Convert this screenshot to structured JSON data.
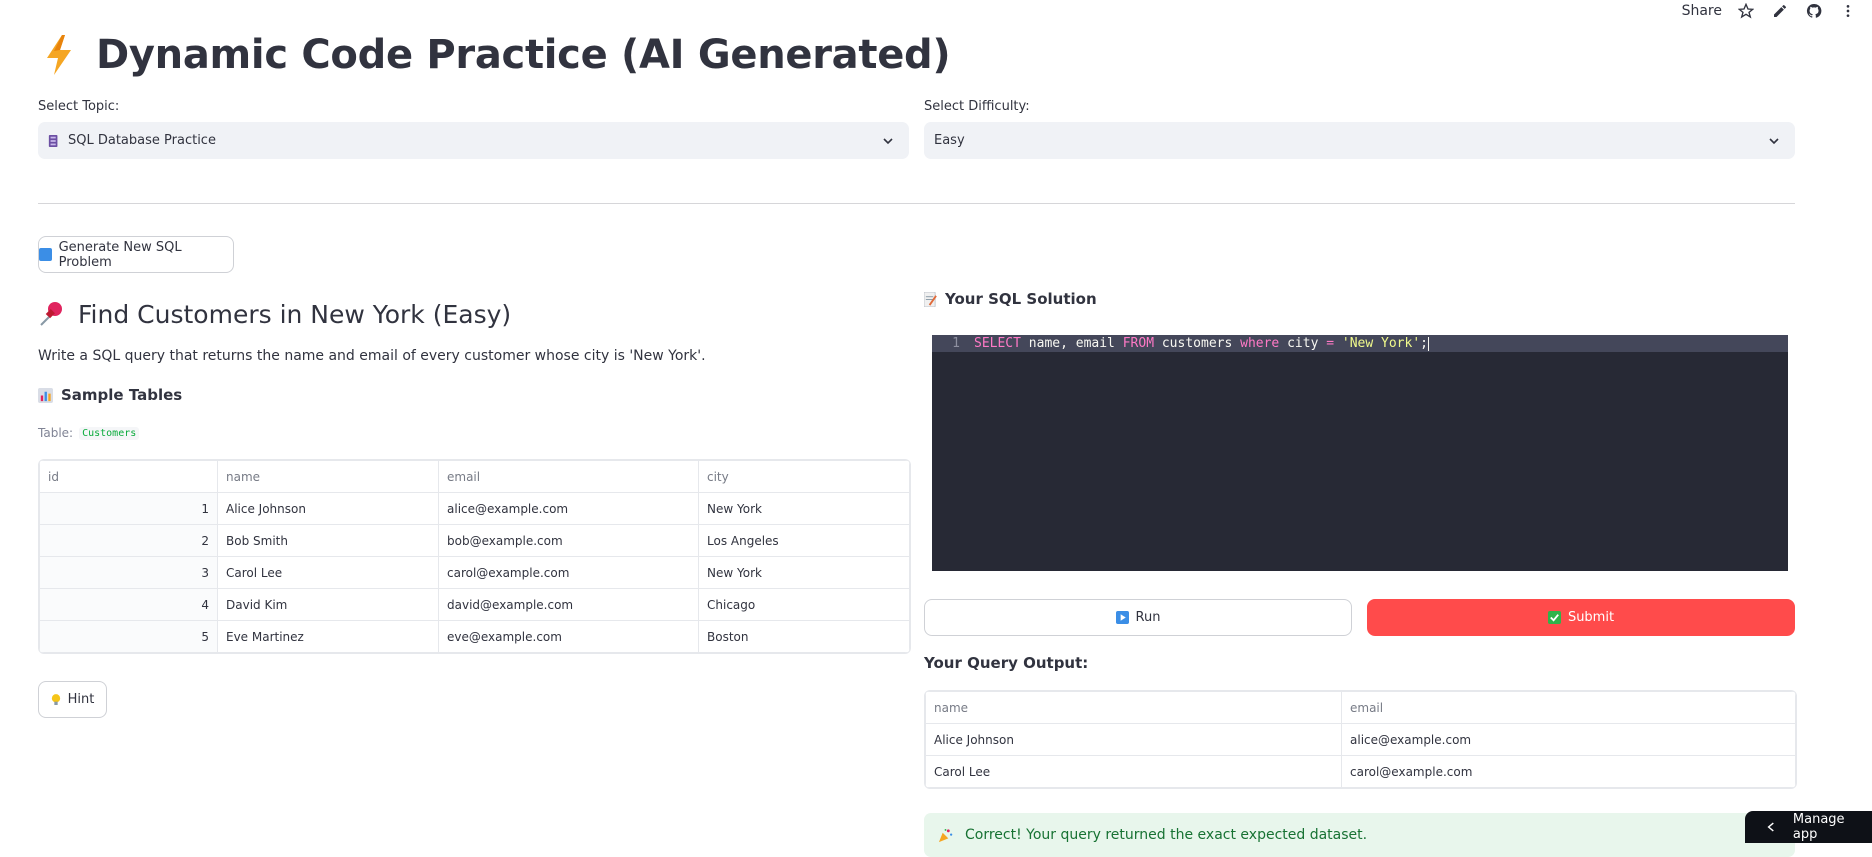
{
  "toolbar": {
    "share_label": "Share"
  },
  "page": {
    "title": "Dynamic Code Practice (AI Generated)"
  },
  "topic": {
    "label": "Select Topic:",
    "value": "SQL Database Practice"
  },
  "difficulty": {
    "label": "Select Difficulty:",
    "value": "Easy"
  },
  "generate_button": {
    "label": "Generate New SQL Problem"
  },
  "problem": {
    "title": "Find Customers in New York (Easy)",
    "description": "Write a SQL query that returns the name and email of every customer whose city is 'New York'.",
    "sample_tables_heading": "Sample Tables",
    "table_prefix": "Table:",
    "table_name": "Customers"
  },
  "customers_table": {
    "columns": [
      "id",
      "name",
      "email",
      "city"
    ],
    "rows": [
      [
        "1",
        "Alice Johnson",
        "alice@example.com",
        "New York"
      ],
      [
        "2",
        "Bob Smith",
        "bob@example.com",
        "Los Angeles"
      ],
      [
        "3",
        "Carol Lee",
        "carol@example.com",
        "New York"
      ],
      [
        "4",
        "David Kim",
        "david@example.com",
        "Chicago"
      ],
      [
        "5",
        "Eve Martinez",
        "eve@example.com",
        "Boston"
      ]
    ]
  },
  "hint_button": {
    "label": "Hint"
  },
  "solution": {
    "heading": "Your SQL Solution",
    "line_number": "1",
    "code": {
      "kw_select": "SELECT",
      "part1": " name, email ",
      "kw_from": "FROM",
      "part2": " customers ",
      "kw_where": "where",
      "part3": " city ",
      "op": "=",
      "part4": " ",
      "str": "'New York'",
      "end": ";"
    }
  },
  "run_button": {
    "label": "Run"
  },
  "submit_button": {
    "label": "Submit"
  },
  "output": {
    "heading": "Your Query Output:",
    "columns": [
      "name",
      "email"
    ],
    "rows": [
      [
        "Alice Johnson",
        "alice@example.com"
      ],
      [
        "Carol Lee",
        "carol@example.com"
      ]
    ]
  },
  "success_message": "Correct! Your query returned the exact expected dataset.",
  "manage_app": {
    "label": "Manage app"
  },
  "colors": {
    "primary": "#ff4b4b",
    "code_bg": "#272935",
    "success_bg": "#e8f6ec"
  }
}
